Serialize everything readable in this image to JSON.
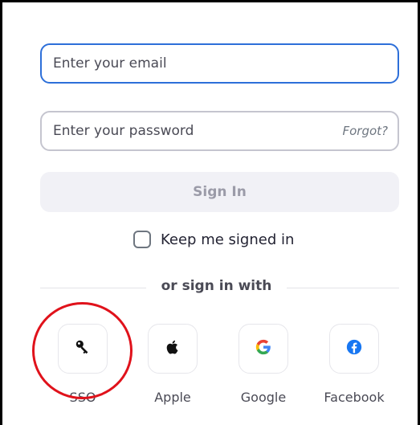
{
  "login": {
    "email_placeholder": "Enter your email",
    "password_placeholder": "Enter your password",
    "forgot_label": "Forgot?",
    "signin_label": "Sign In",
    "keep_signed_in_label": "Keep me signed in",
    "keep_signed_in_checked": false
  },
  "divider": {
    "label": "or sign in with"
  },
  "providers": [
    {
      "label": "SSO",
      "icon": "key-icon"
    },
    {
      "label": "Apple",
      "icon": "apple-icon"
    },
    {
      "label": "Google",
      "icon": "google-icon"
    },
    {
      "label": "Facebook",
      "icon": "facebook-icon"
    }
  ],
  "colors": {
    "accent": "#2d6fd9",
    "highlight": "#e0121b",
    "facebook": "#1877f2"
  }
}
